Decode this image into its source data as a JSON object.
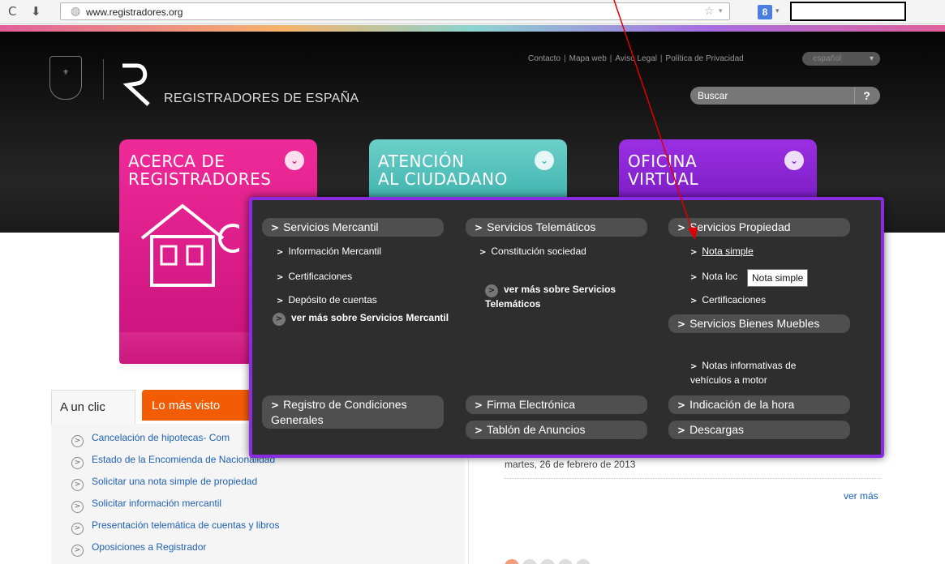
{
  "browser": {
    "url": "www.registradores.org",
    "reload_icon": "C",
    "download_icon": "⬇",
    "star_icon": "☆",
    "dropdown_icon": "▾",
    "search_engine_letter": "8"
  },
  "header": {
    "site_name": "REGISTRADORES DE ESPAÑA",
    "top_links": [
      "Contacto",
      "Mapa web",
      "Aviso Legal",
      "Política de Privacidad"
    ],
    "language": "español",
    "search_placeholder": "Buscar"
  },
  "nav_cards": [
    {
      "title": "ACERCA DE\nREGISTRADORES",
      "color": "#e2208c"
    },
    {
      "title": "ATENCIÓN\nAL CIUDADANO",
      "color": "#4cbdb8"
    },
    {
      "title": "OFICINA\nVIRTUAL",
      "color": "#8a2be2"
    }
  ],
  "megamenu": {
    "col1": {
      "heading": "Servicios Mercantil",
      "items": [
        "Información Mercantil",
        "Certificaciones",
        "Depósito de cuentas"
      ],
      "more": "ver más sobre Servicios Mercantil",
      "bottom": "Registro de Condiciones Generales"
    },
    "col2": {
      "heading": "Servicios Telemáticos",
      "items": [
        "Constitución sociedad"
      ],
      "more": "ver más sobre Servicios Telemáticos",
      "bottom": [
        "Firma Electrónica",
        "Tablón de Anuncios"
      ]
    },
    "col3": {
      "heading": "Servicios Propiedad",
      "items": [
        "Nota simple",
        "Nota loc",
        "Certificaciones"
      ],
      "heading2": "Servicios Bienes Muebles",
      "items2": [
        "Notas informativas de vehículos a motor"
      ],
      "bottom": [
        "Indicación de la hora",
        "Descargas"
      ]
    },
    "tooltip": "Nota simple"
  },
  "tabs": {
    "active": "A un clic",
    "other": "Lo más visto"
  },
  "quick_links": [
    "Cancelación de hipotecas- Com",
    "Estado de la Encomienda de Nacionalidad",
    "Solicitar una nota simple de propiedad",
    "Solicitar información mercantil",
    "Presentación telemática de cuentas y libros",
    "Oposiciones a Registrador"
  ],
  "news": {
    "date": "martes, 26 de febrero de 2013",
    "more": "ver más"
  },
  "colors": {
    "magenta": "#e2208c",
    "teal": "#4cbdb8",
    "purple": "#8a2be2",
    "orange": "#f25c05",
    "link_blue": "#1f5fb4",
    "annotation_red": "#e00000"
  }
}
